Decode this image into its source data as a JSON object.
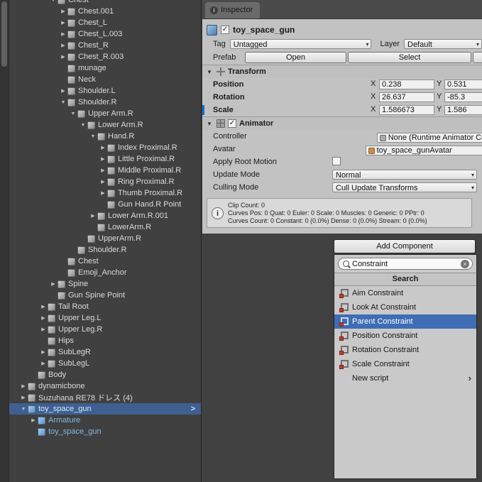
{
  "hierarchy": {
    "items": [
      {
        "label": "Chest",
        "level": 4,
        "arrow": "down"
      },
      {
        "label": "Chest.001",
        "level": 5,
        "arrow": "right"
      },
      {
        "label": "Chest_L",
        "level": 5,
        "arrow": "right"
      },
      {
        "label": "Chest_L.003",
        "level": 5,
        "arrow": "right"
      },
      {
        "label": "Chest_R",
        "level": 5,
        "arrow": "right"
      },
      {
        "label": "Chest_R.003",
        "level": 5,
        "arrow": "right"
      },
      {
        "label": "munage",
        "level": 5,
        "arrow": "none"
      },
      {
        "label": "Neck",
        "level": 5,
        "arrow": "none"
      },
      {
        "label": "Shoulder.L",
        "level": 5,
        "arrow": "right"
      },
      {
        "label": "Shoulder.R",
        "level": 5,
        "arrow": "down"
      },
      {
        "label": "Upper Arm.R",
        "level": 6,
        "arrow": "down"
      },
      {
        "label": "Lower Arm.R",
        "level": 7,
        "arrow": "down"
      },
      {
        "label": "Hand.R",
        "level": 8,
        "arrow": "down"
      },
      {
        "label": "Index Proximal.R",
        "level": 9,
        "arrow": "right"
      },
      {
        "label": "Little Proximal.R",
        "level": 9,
        "arrow": "right"
      },
      {
        "label": "Middle Proximal.R",
        "level": 9,
        "arrow": "right"
      },
      {
        "label": "Ring Proximal.R",
        "level": 9,
        "arrow": "right"
      },
      {
        "label": "Thumb Proximal.R",
        "level": 9,
        "arrow": "right"
      },
      {
        "label": "Gun Hand.R Point",
        "level": 9,
        "arrow": "none"
      },
      {
        "label": "Lower Arm.R.001",
        "level": 8,
        "arrow": "right"
      },
      {
        "label": "LowerArm.R",
        "level": 8,
        "arrow": "none"
      },
      {
        "label": "UpperArm.R",
        "level": 7,
        "arrow": "none"
      },
      {
        "label": "Shoulder.R",
        "level": 6,
        "arrow": "none"
      },
      {
        "label": "Chest",
        "level": 5,
        "arrow": "none"
      },
      {
        "label": "Emoji_Anchor",
        "level": 5,
        "arrow": "none"
      },
      {
        "label": "Spine",
        "level": 4,
        "arrow": "right"
      },
      {
        "label": "Gun Spine Point",
        "level": 4,
        "arrow": "none"
      },
      {
        "label": "Tail Root",
        "level": 3,
        "arrow": "right"
      },
      {
        "label": "Upper Leg.L",
        "level": 3,
        "arrow": "right"
      },
      {
        "label": "Upper Leg.R",
        "level": 3,
        "arrow": "right"
      },
      {
        "label": "Hips",
        "level": 3,
        "arrow": "none"
      },
      {
        "label": "SubLegR",
        "level": 3,
        "arrow": "right"
      },
      {
        "label": "SubLegL",
        "level": 3,
        "arrow": "right"
      },
      {
        "label": "Body",
        "level": 2,
        "arrow": "none"
      },
      {
        "label": "dynamicbone",
        "level": 1,
        "arrow": "right"
      },
      {
        "label": "Suzuhana RE78 ドレス (4)",
        "level": 1,
        "arrow": "right"
      },
      {
        "label": "toy_space_gun",
        "level": 1,
        "arrow": "down",
        "selected": true,
        "prefab": true
      },
      {
        "label": "Armature",
        "level": 2,
        "arrow": "right",
        "prefab": true
      },
      {
        "label": "toy_space_gun",
        "level": 2,
        "arrow": "none",
        "prefab": true
      }
    ]
  },
  "inspector": {
    "tab_label": "Inspector",
    "header": {
      "title": "toy_space_gun",
      "enabled": true
    },
    "tag_row": {
      "tag_label": "Tag",
      "tag_value": "Untagged",
      "layer_label": "Layer",
      "layer_value": "Default"
    },
    "prefab_row": {
      "label": "Prefab",
      "open_label": "Open",
      "select_label": "Select"
    },
    "transform": {
      "title": "Transform",
      "axis_x": "X",
      "axis_y": "Y",
      "rows": [
        {
          "label": "Position",
          "x": "0.238",
          "y": "0.531",
          "override": false
        },
        {
          "label": "Rotation",
          "x": "26.637",
          "y": "-85.3",
          "override": false
        },
        {
          "label": "Scale",
          "x": "1.586673",
          "y": "1.586",
          "override": true
        }
      ]
    },
    "animator": {
      "title": "Animator",
      "enabled": true,
      "controller_label": "Controller",
      "controller_value": "None (Runtime Animator Con",
      "avatar_label": "Avatar",
      "avatar_value": "toy_space_gunAvatar",
      "apply_root_motion_label": "Apply Root Motion",
      "apply_root_motion_checked": false,
      "update_mode_label": "Update Mode",
      "update_mode_value": "Normal",
      "culling_mode_label": "Culling Mode",
      "culling_mode_value": "Cull Update Transforms",
      "info_lines": [
        "Clip Count: 0",
        "Curves Pos: 0 Quat: 0 Euler: 0 Scale: 0 Muscles: 0 Generic: 0 PPtr: 0",
        "Curves Count: 0 Constant: 0 (0.0%) Dense: 0 (0.0%) Stream: 0 (0.0%)"
      ]
    }
  },
  "add_component": {
    "button_label": "Add Component",
    "search_value": "Constraint",
    "section_header": "Search",
    "selected_index": 2,
    "items": [
      {
        "label": "Aim Constraint",
        "icon": "aim-constraint-icon"
      },
      {
        "label": "Look At Constraint",
        "icon": "look-at-constraint-icon"
      },
      {
        "label": "Parent Constraint",
        "icon": "parent-constraint-icon",
        "selected": true
      },
      {
        "label": "Position Constraint",
        "icon": "position-constraint-icon"
      },
      {
        "label": "Rotation Constraint",
        "icon": "rotation-constraint-icon"
      },
      {
        "label": "Scale Constraint",
        "icon": "scale-constraint-icon"
      },
      {
        "label": "New script",
        "icon": null,
        "has_submenu": true
      }
    ]
  },
  "colors": {
    "hierarchy_selection_blue": "#3d6091",
    "prefab_text_blue": "#84b7e2",
    "inspector_bg": "#c2c2c2",
    "list_selection_blue": "#3e6db5",
    "override_blue": "#0f6cd1",
    "constraint_icon_red": "#c0392b"
  }
}
